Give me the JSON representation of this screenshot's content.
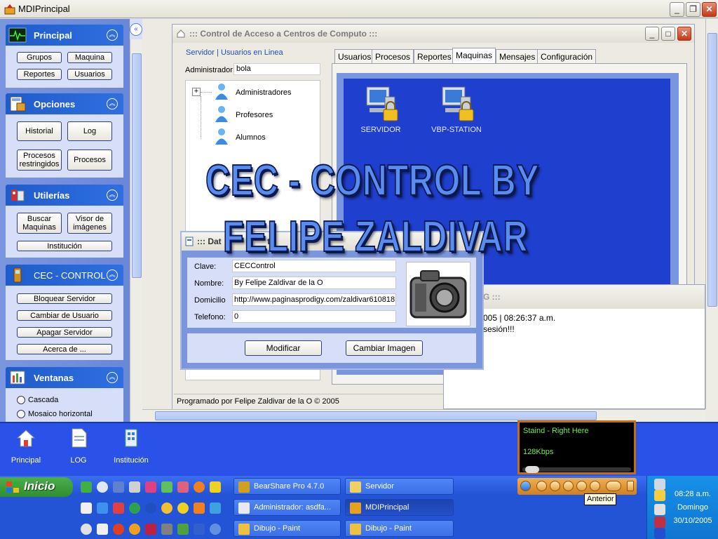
{
  "window": {
    "title": "MDIPrincipal"
  },
  "sidebar": {
    "groups": [
      {
        "title": "Principal",
        "buttons": [
          "Grupos",
          "Maquina",
          "Reportes",
          "Usuarios"
        ]
      },
      {
        "title": "Opciones",
        "buttons": [
          "Historial",
          "Log",
          "Procesos restringidos",
          "Procesos"
        ]
      },
      {
        "title": "Utilerías",
        "buttons": [
          "Buscar Maquinas",
          "Visor de imágenes",
          "Institución"
        ]
      },
      {
        "title": "CEC - CONTROL",
        "buttons": [
          "Bloquear Servidor",
          "Cambiar de Usuario",
          "Apagar Servidor",
          "Acerca de ..."
        ]
      },
      {
        "title": "Ventanas",
        "options": [
          "Cascada",
          "Mosaico horizontal"
        ]
      }
    ]
  },
  "control_window": {
    "title": "::: Control de Acceso a Centros de Computo :::",
    "links": [
      "Servidor",
      "Usuarios en Linea"
    ],
    "link_sep": "|",
    "admin_label": "Administrador:",
    "admin_value": "bola",
    "tree": [
      "Administradores",
      "Profesores",
      "Alumnos"
    ],
    "tabs": [
      "Usuarios",
      "Procesos",
      "Reportes",
      "Maquinas",
      "Mensajes",
      "Configuración"
    ],
    "active_tab": "Maquinas",
    "machines": [
      "SERVIDOR",
      "VBP-STATION"
    ],
    "status": "Programado por Felipe Zaldivar de la O  © 2005"
  },
  "overlay": {
    "line1": "CEC - CONTROL  BY",
    "line2": "FELIPE ZALDIVAR"
  },
  "log_window": {
    "title_fragment": "G :::",
    "line1": "005 | 08:26:37 a.m.",
    "line2": "sesión!!!"
  },
  "dialog": {
    "title_fragment": "::: Dat",
    "title_fragment2": "ti",
    "fields": [
      {
        "label": "Clave:",
        "value": "CECControl"
      },
      {
        "label": "Nombre:",
        "value": "By Felipe Zaldivar de la O"
      },
      {
        "label": "Domicilio",
        "value": "http://www.paginasprodigy.com/zaldivar610818"
      },
      {
        "label": "Telefono:",
        "value": "0"
      }
    ],
    "buttons": [
      "Modificar",
      "Cambiar  Imagen"
    ]
  },
  "bottom_toolbar": {
    "items": [
      "Principal",
      "LOG",
      "Institución"
    ]
  },
  "player": {
    "track": "Staind - Right Here",
    "rate": "128Kbps"
  },
  "taskbar": {
    "start_label": "Inicio",
    "tasks": [
      "BearShare Pro 4.7.0",
      "Servidor",
      "Administrador: asdfa...",
      "MDIPrincipal",
      "Dibujo - Paint",
      "Dibujo - Paint"
    ],
    "active_task": "MDIPrincipal",
    "tooltip": "Anterior",
    "clock": {
      "time": "08:28 a.m.",
      "day": "Domingo",
      "date": "30/10/2005"
    }
  }
}
